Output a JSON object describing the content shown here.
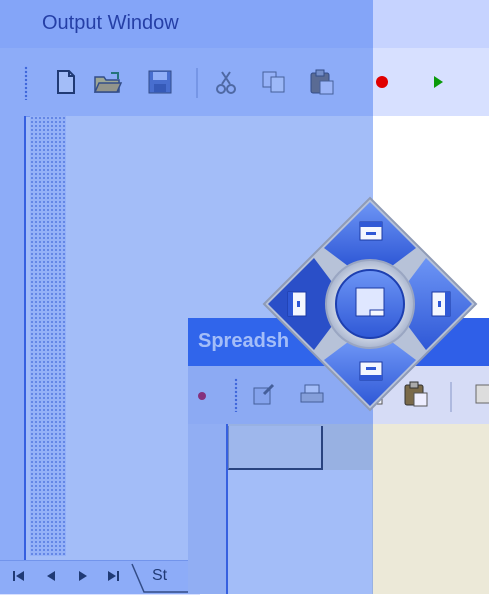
{
  "output_window": {
    "title": "Output Window",
    "toolbar_icons": [
      "new-document-icon",
      "open-folder-icon",
      "save-icon",
      "cut-icon",
      "copy-icon",
      "paste-icon",
      "record-icon",
      "play-icon"
    ],
    "nav_buttons": [
      "first-icon",
      "prev-icon",
      "next-icon",
      "last-icon"
    ],
    "tab_label": "St"
  },
  "spreadsheet_window": {
    "title": "Spreadsh",
    "toolbar_icons": [
      "edit-icon",
      "print-icon",
      "copy-icon",
      "paste-icon"
    ]
  },
  "dock_compass": {
    "targets": [
      "dock-top",
      "dock-left",
      "dock-center",
      "dock-right",
      "dock-bottom"
    ]
  },
  "colors": {
    "overlay": "#346cf0",
    "title_active": "#2f5fe8",
    "compass_blue": "#3b6ee6"
  }
}
